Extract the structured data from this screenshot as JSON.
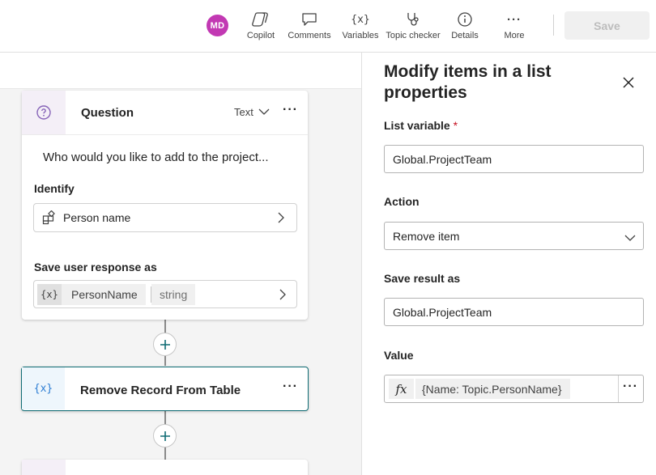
{
  "toolbar": {
    "avatar_initials": "MD",
    "avatar_color": "#c239b3",
    "items": [
      {
        "label": "Copilot",
        "icon": "copilot-icon"
      },
      {
        "label": "Comments",
        "icon": "comment-icon"
      },
      {
        "label": "Variables",
        "icon": "variables-icon"
      },
      {
        "label": "Topic checker",
        "icon": "stethoscope-icon"
      },
      {
        "label": "Details",
        "icon": "info-icon"
      },
      {
        "label": "More",
        "icon": "more-icon"
      }
    ],
    "save_label": "Save"
  },
  "canvas": {
    "question_node": {
      "title": "Question",
      "type_label": "Text",
      "prompt": "Who would you like to add to the project...",
      "identify_label": "Identify",
      "identify_value": "Person name",
      "save_label": "Save user response as",
      "var_icon": "{x}",
      "var_name": "PersonName",
      "var_type": "string"
    },
    "remove_node": {
      "icon_text": "{x}",
      "title": "Remove Record From Table"
    }
  },
  "panel": {
    "title": "Modify items in a list properties",
    "list_variable_label": "List variable",
    "required_marker": "*",
    "list_variable_value": "Global.ProjectTeam",
    "action_label": "Action",
    "action_value": "Remove item",
    "save_result_label": "Save result as",
    "save_result_value": "Global.ProjectTeam",
    "value_label": "Value",
    "value_fx": "fx",
    "value_formula": "{Name: Topic.PersonName}"
  },
  "colors": {
    "accent_teal": "#0f6c74",
    "question_icon": "#8764b8"
  }
}
